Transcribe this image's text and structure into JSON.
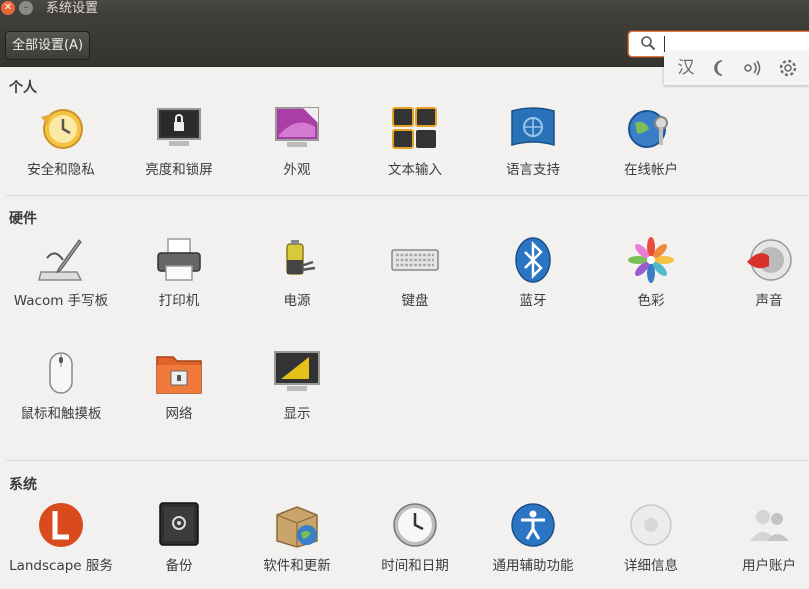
{
  "window": {
    "title": "系统设置"
  },
  "toolbar": {
    "all_settings_label": "全部设置(A)",
    "search_value": ""
  },
  "tray": {
    "icons": [
      "ime-icon",
      "night-icon",
      "sound-icon",
      "gear-icon"
    ],
    "ime_label": "汉"
  },
  "sections": {
    "personal": {
      "title": "个人",
      "items": [
        {
          "label": "安全和隐私",
          "icon": "privacy-clock-icon"
        },
        {
          "label": "亮度和锁屏",
          "icon": "lock-screen-icon"
        },
        {
          "label": "外观",
          "icon": "appearance-icon"
        },
        {
          "label": "文本输入",
          "icon": "text-entry-icon"
        },
        {
          "label": "语言支持",
          "icon": "language-flag-icon"
        },
        {
          "label": "在线帐户",
          "icon": "online-accounts-icon"
        }
      ]
    },
    "hardware": {
      "title": "硬件",
      "items": [
        {
          "label": "Wacom 手写板",
          "icon": "wacom-tablet-icon"
        },
        {
          "label": "打印机",
          "icon": "printer-icon"
        },
        {
          "label": "电源",
          "icon": "battery-power-icon"
        },
        {
          "label": "键盘",
          "icon": "keyboard-icon"
        },
        {
          "label": "蓝牙",
          "icon": "bluetooth-icon"
        },
        {
          "label": "色彩",
          "icon": "color-icon"
        },
        {
          "label": "声音",
          "icon": "sound-icon"
        },
        {
          "label": "鼠标和触摸板",
          "icon": "mouse-icon"
        },
        {
          "label": "网络",
          "icon": "network-folder-icon"
        },
        {
          "label": "显示",
          "icon": "display-icon"
        }
      ]
    },
    "system": {
      "title": "系统",
      "items": [
        {
          "label": "Landscape 服务",
          "icon": "landscape-icon"
        },
        {
          "label": "备份",
          "icon": "backup-safe-icon"
        },
        {
          "label": "软件和更新",
          "icon": "software-update-icon"
        },
        {
          "label": "时间和日期",
          "icon": "clock-icon"
        },
        {
          "label": "通用辅助功能",
          "icon": "accessibility-icon"
        },
        {
          "label": "详细信息",
          "icon": "details-icon"
        },
        {
          "label": "用户账户",
          "icon": "user-accounts-icon"
        }
      ]
    }
  },
  "colors": {
    "accent": "#e17a3f",
    "titlebar": "#3c3b37",
    "background": "#f2f1f0"
  }
}
